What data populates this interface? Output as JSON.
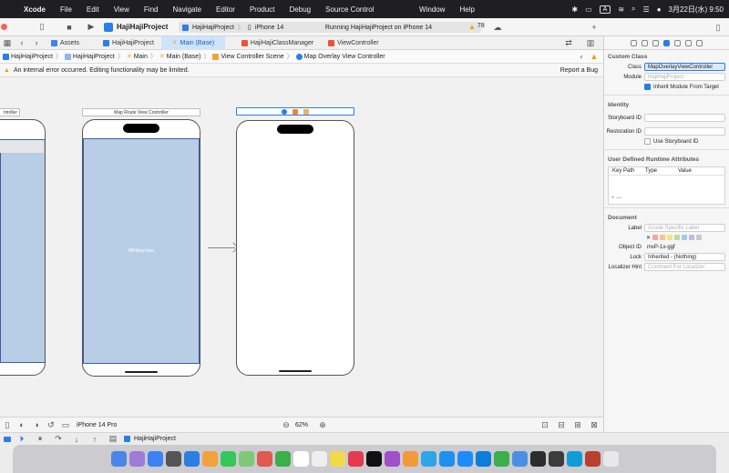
{
  "menubar": {
    "app_name": "Xcode",
    "items": [
      "File",
      "Edit",
      "View",
      "Find",
      "Navigate",
      "Editor",
      "Product",
      "Debug",
      "Source Control"
    ],
    "right_items": [
      "Window",
      "Help"
    ],
    "input_label": "A",
    "clock": "3月22日(水) 9:50"
  },
  "toolbar": {
    "scheme_name": "HajiHajiProject",
    "destination_project": "HajiHajiProject",
    "destination_device": "iPhone 14",
    "status": "Running HajiHajiProject on iPhone 14",
    "warning_count": "78"
  },
  "tabs": [
    {
      "label": "Assets",
      "color": "#3b82f6"
    },
    {
      "label": "HajiHajiProject",
      "color": "#2b7de9"
    },
    {
      "label": "Main (Base)",
      "color": "#f2a23a"
    },
    {
      "label": "HajiHajiClassManager",
      "color": "#f05138"
    },
    {
      "label": "ViewController",
      "color": "#f05138"
    }
  ],
  "jumpbar": {
    "crumbs": [
      "HajiHajiProject",
      "HajiHajiProject",
      "Main",
      "Main (Base)",
      "View Controller Scene",
      "Map Overlay View Controller"
    ]
  },
  "errorbar": {
    "message": "An internal error occurred. Editing functionality may be limited.",
    "report": "Report a Bug"
  },
  "canvas": {
    "scene1_label": "ntroller",
    "scene2_label": "Map Route View Controller",
    "mapview_label": "MKMapView"
  },
  "bottombar": {
    "device": "iPhone 14 Pro",
    "zoom": "62%"
  },
  "debugbar": {
    "target": "HajiHajiProject"
  },
  "inspector": {
    "custom_class_title": "Custom Class",
    "class_label": "Class",
    "class_value": "MapOverlayViewController",
    "module_label": "Module",
    "module_placeholder": "HajiHajiProject",
    "inherit_label": "Inherit Module From Target",
    "identity_title": "Identity",
    "storyboard_id_label": "Storyboard ID",
    "restoration_id_label": "Restoration ID",
    "use_storyboard_id_label": "Use Storyboard ID",
    "udra_title": "User Defined Runtime Attributes",
    "col_key_path": "Key Path",
    "col_type": "Type",
    "col_value": "Value",
    "document_title": "Document",
    "label_label": "Label",
    "label_placeholder": "Xcode Specific Label",
    "object_id_label": "Object ID",
    "object_id_value": "mvP-1x-ggf",
    "lock_label": "Lock",
    "lock_value": "Inherited - (Nothing)",
    "localizer_label": "Localizer Hint",
    "localizer_placeholder": "Comment For Localizer",
    "swatch_colors": [
      "#f3a6a6",
      "#f6c48a",
      "#f4e28a",
      "#b6e0a0",
      "#a9c8f0",
      "#c9b3ec",
      "#c8c8c8"
    ]
  },
  "dock_colors": [
    "#4a86e8",
    "#9e7dd6",
    "#3b82f6",
    "#555555",
    "#2a7fe0",
    "#f2a23a",
    "#34c759",
    "#eeeeee",
    "#e05a4e",
    "#ffffff",
    "#f2d94a",
    "#e23b4e",
    "#111111",
    "#6b4fe0",
    "#a14ec9",
    "#f29a38",
    "#2fa4e7",
    "#1ba0f2",
    "#1d8ff0",
    "#1a8cff",
    "#0b7ddb",
    "#3aaf4a",
    "#4a90e2",
    "#2c2c2c",
    "#3c3c3c",
    "#0e9cd8",
    "#b8402f",
    "#ffffff"
  ]
}
